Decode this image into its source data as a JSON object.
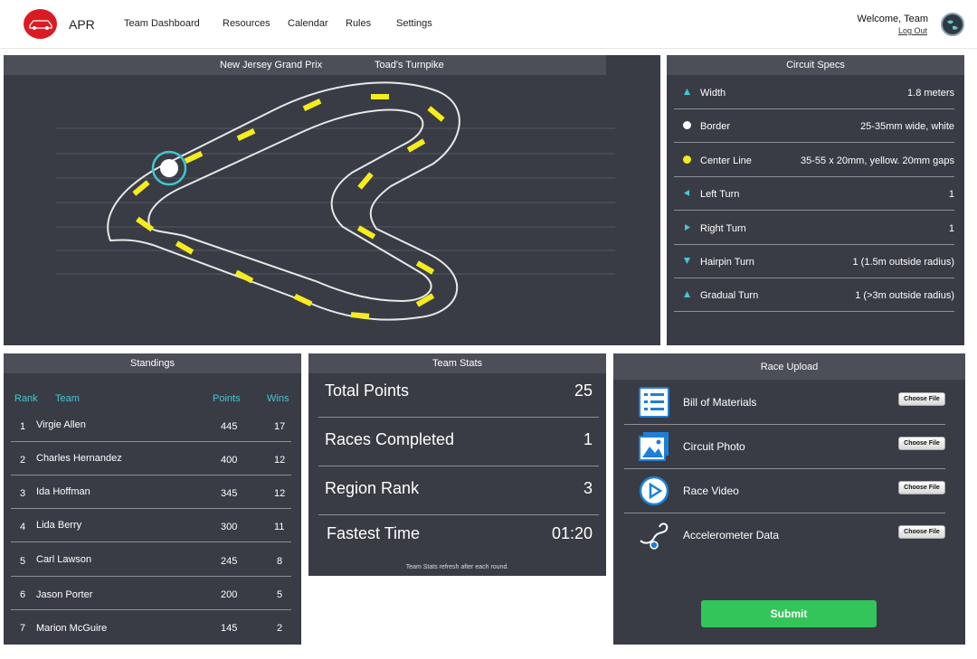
{
  "header": {
    "brand": "APR",
    "nav": [
      "Team Dashboard",
      "Resources",
      "Calendar",
      "Rules",
      "Settings"
    ],
    "welcome": "Welcome, Team",
    "logout": "Log Out"
  },
  "circuit": {
    "race_name": "New Jersey Grand Prix",
    "track_name": "Toad's Turnpike"
  },
  "specs": {
    "title": "Circuit Specs",
    "rows": [
      {
        "label": "Width",
        "value": "1.8 meters",
        "icon": "triangle-up-icon"
      },
      {
        "label": "Border",
        "value": "25-35mm wide, white",
        "icon": "white-dot-icon"
      },
      {
        "label": "Center Line",
        "value": "35-55 x 20mm, yellow. 20mm gaps",
        "icon": "yellow-dot-icon"
      },
      {
        "label": "Left Turn",
        "value": "1",
        "icon": "triangle-left-icon"
      },
      {
        "label": "Right Turn",
        "value": "1",
        "icon": "triangle-right-icon"
      },
      {
        "label": "Hairpin Turn",
        "value": "1 (1.5m outside radius)",
        "icon": "triangle-down-icon"
      },
      {
        "label": "Gradual Turn",
        "value": "1 (>3m outside radius)",
        "icon": "triangle-up-icon"
      }
    ]
  },
  "standings": {
    "title": "Standings",
    "headers": {
      "rank": "Rank",
      "team": "Team",
      "points": "Points",
      "wins": "Wins"
    },
    "rows": [
      {
        "rank": "1",
        "team": "Virgie Allen",
        "points": "445",
        "wins": "17"
      },
      {
        "rank": "2",
        "team": "Charles Hernandez",
        "points": "400",
        "wins": "12"
      },
      {
        "rank": "3",
        "team": "Ida Hoffman",
        "points": "345",
        "wins": "12"
      },
      {
        "rank": "4",
        "team": "Lida Berry",
        "points": "300",
        "wins": "11"
      },
      {
        "rank": "5",
        "team": "Carl Lawson",
        "points": "245",
        "wins": "8"
      },
      {
        "rank": "6",
        "team": "Jason Porter",
        "points": "200",
        "wins": "5"
      },
      {
        "rank": "7",
        "team": "Marion McGuire",
        "points": "145",
        "wins": "2"
      }
    ]
  },
  "team_stats": {
    "title": "Team Stats",
    "rows": [
      {
        "label": "Total Points",
        "value": "25"
      },
      {
        "label": "Races Completed",
        "value": "1"
      },
      {
        "label": "Region Rank",
        "value": "3"
      },
      {
        "label": "Fastest Time",
        "value": "01:20"
      }
    ],
    "note": "Team Stats refresh after each round."
  },
  "race_upload": {
    "title": "Race Upload",
    "rows": [
      {
        "label": "Bill of Materials",
        "button": "Choose File",
        "icon": "list-document-icon"
      },
      {
        "label": "Circuit Photo",
        "button": "Choose File",
        "icon": "photo-icon"
      },
      {
        "label": "Race Video",
        "button": "Choose File",
        "icon": "play-video-icon"
      },
      {
        "label": "Accelerometer Data",
        "button": "Choose File",
        "icon": "stethoscope-sensor-icon"
      }
    ],
    "submit": "Submit"
  },
  "colors": {
    "panel": "#393c44",
    "panel_title": "#4c4f58",
    "accent_cyan": "#45c6d6",
    "center_line_yellow": "#f6ec1c",
    "submit_green": "#33c559",
    "logo_red": "#d91c24"
  }
}
